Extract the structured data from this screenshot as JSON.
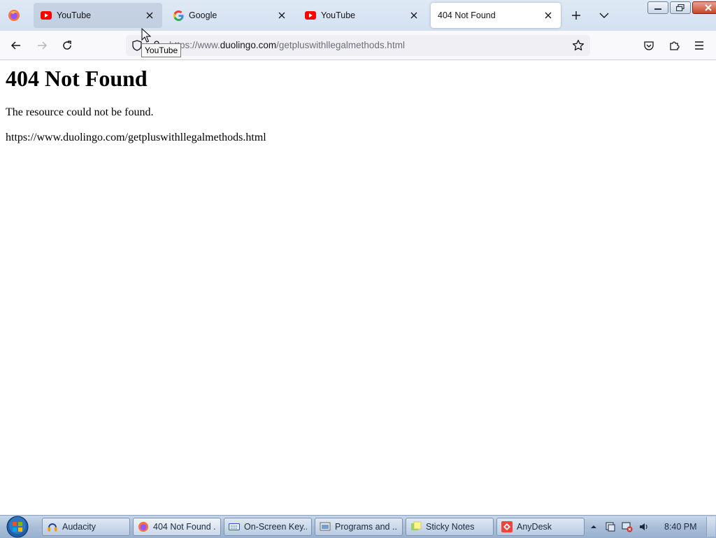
{
  "browser": {
    "tabs": [
      {
        "title": "YouTube",
        "favicon": "youtube-icon",
        "state": "hover"
      },
      {
        "title": "Google",
        "favicon": "google-icon",
        "state": "normal"
      },
      {
        "title": "YouTube",
        "favicon": "youtube-icon",
        "state": "normal"
      },
      {
        "title": "404 Not Found",
        "favicon": "",
        "state": "active"
      }
    ],
    "url": {
      "prefix": "https://www.",
      "domain": "duolingo.com",
      "path": "/getpluswithllegalmethods.html"
    },
    "tooltip": "YouTube"
  },
  "page": {
    "heading": "404 Not Found",
    "message": "The resource could not be found.",
    "url_text": "https://www.duolingo.com/getpluswithllegalmethods.html"
  },
  "taskbar": {
    "items": [
      {
        "label": "Audacity",
        "icon": "audacity-icon"
      },
      {
        "label": "404 Not Found ...",
        "icon": "firefox-icon",
        "active": true
      },
      {
        "label": "On-Screen Key...",
        "icon": "keyboard-icon"
      },
      {
        "label": "Programs and ...",
        "icon": "programs-icon"
      },
      {
        "label": "Sticky Notes",
        "icon": "sticky-notes-icon"
      },
      {
        "label": "AnyDesk",
        "icon": "anydesk-icon"
      }
    ],
    "clock": "8:40 PM"
  },
  "colors": {
    "youtube_red": "#ff0000",
    "tab_active_bg": "#ffffff",
    "taskbar_bg": "#a9bed8"
  }
}
